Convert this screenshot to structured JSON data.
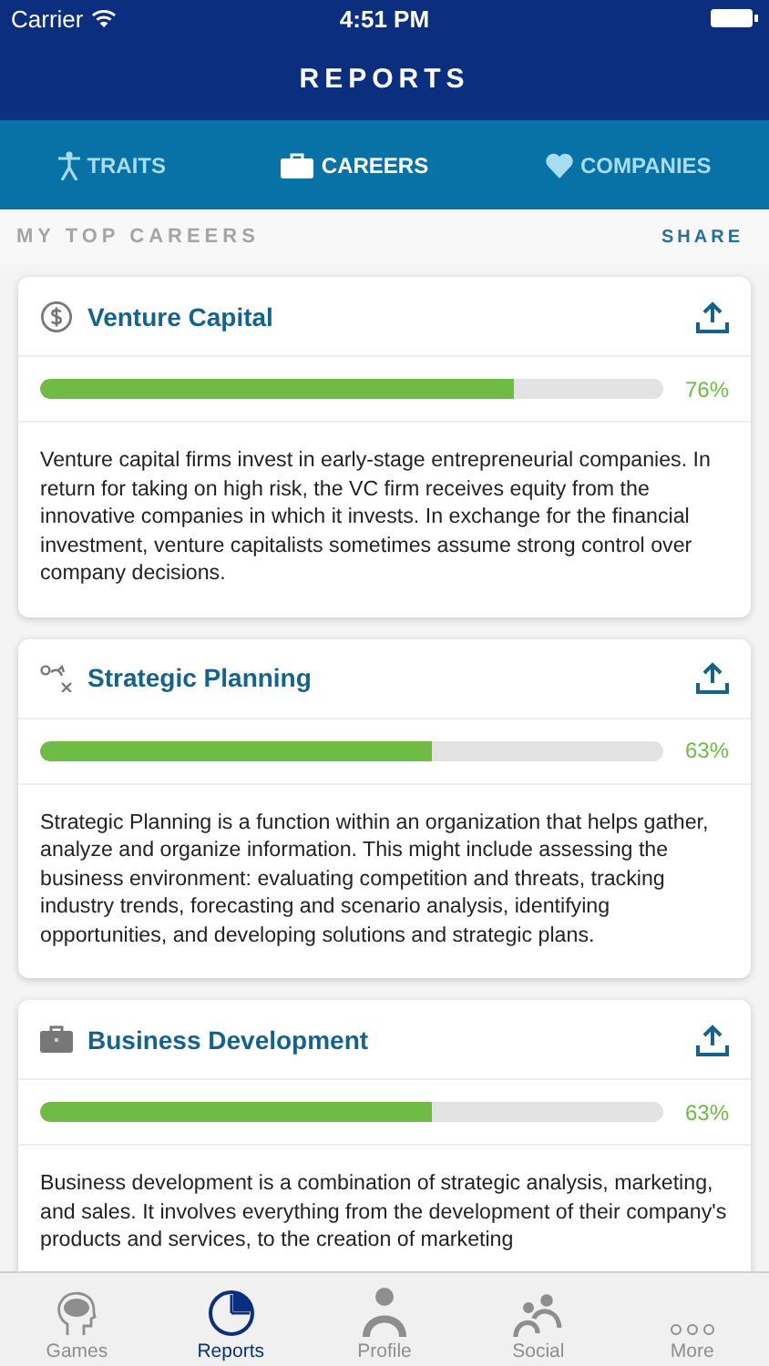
{
  "status_bar": {
    "carrier": "Carrier",
    "time": "4:51 PM"
  },
  "header": {
    "title": "REPORTS"
  },
  "tabs": [
    {
      "label": "TRAITS",
      "kind": "figure",
      "selected": false
    },
    {
      "label": "CAREERS",
      "kind": "briefcase",
      "selected": true
    },
    {
      "label": "COMPANIES",
      "kind": "heart",
      "selected": false
    }
  ],
  "section": {
    "title": "MY TOP CAREERS",
    "action": "SHARE"
  },
  "careers": [
    {
      "kind": "dollar",
      "title": "Venture Capital",
      "level": 0.76,
      "percent": "76%",
      "description": "Venture capital firms invest in early-stage entrepreneurial companies. In return for taking on high risk, the VC firm receives equity from the innovative companies in which it invests. In exchange for the financial investment, venture capitalists sometimes assume strong control over company decisions."
    },
    {
      "kind": "strategy",
      "title": "Strategic Planning",
      "level": 0.63,
      "percent": "63%",
      "description": "Strategic Planning is a function within an organization that helps gather, analyze and organize information. This might include assessing the business environment: evaluating competition and threats, tracking industry trends, forecasting and scenario analysis, identifying opportunities, and developing solutions and strategic plans."
    },
    {
      "kind": "briefcase",
      "title": "Business Development",
      "level": 0.63,
      "percent": "63%",
      "description": "Business development is a combination of strategic analysis, marketing, and sales. It involves everything from the development of their company's products and services, to the creation of marketing"
    }
  ],
  "tab_bar": [
    {
      "label": "Games",
      "kind": "head",
      "selected": false
    },
    {
      "label": "Reports",
      "kind": "pie",
      "selected": true
    },
    {
      "label": "Profile",
      "kind": "person",
      "selected": false
    },
    {
      "label": "Social",
      "kind": "people",
      "selected": false
    },
    {
      "label": "More",
      "kind": "dots",
      "selected": false
    }
  ]
}
